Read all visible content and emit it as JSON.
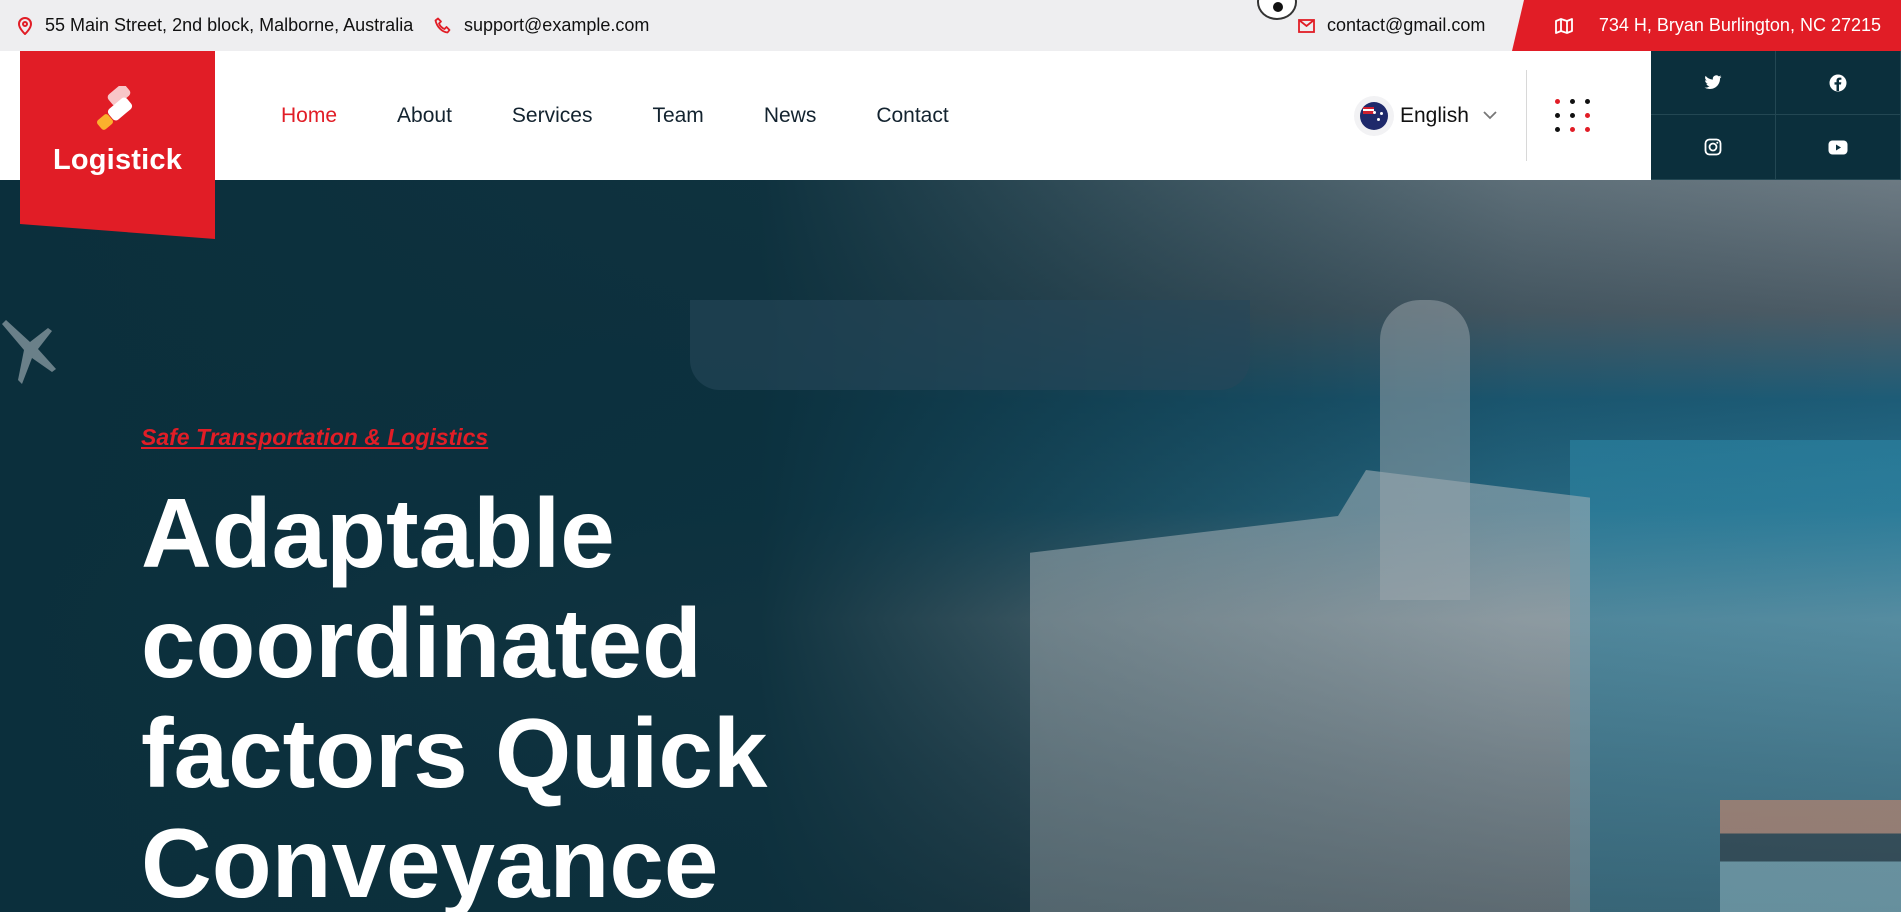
{
  "topbar": {
    "address": "55 Main Street, 2nd block, Malborne, Australia",
    "support_email": "support@example.com",
    "contact_email": "contact@gmail.com",
    "office_address": "734 H, Bryan Burlington, NC 27215"
  },
  "brand": {
    "name": "Logistick",
    "accent": "#e11d26",
    "dark": "#0b2f3c"
  },
  "nav": {
    "items": [
      {
        "label": "Home",
        "active": true
      },
      {
        "label": "About"
      },
      {
        "label": "Services"
      },
      {
        "label": "Team"
      },
      {
        "label": "News"
      },
      {
        "label": "Contact"
      }
    ]
  },
  "language": {
    "selected": "English",
    "flag": "australia-flag-icon"
  },
  "social": [
    "twitter-icon",
    "facebook-icon",
    "instagram-icon",
    "youtube-icon"
  ],
  "hero": {
    "subtitle": "Safe Transportation & Logistics",
    "title_lines": [
      "Adaptable",
      "coordinated",
      "factors Quick",
      "Conveyance"
    ]
  }
}
